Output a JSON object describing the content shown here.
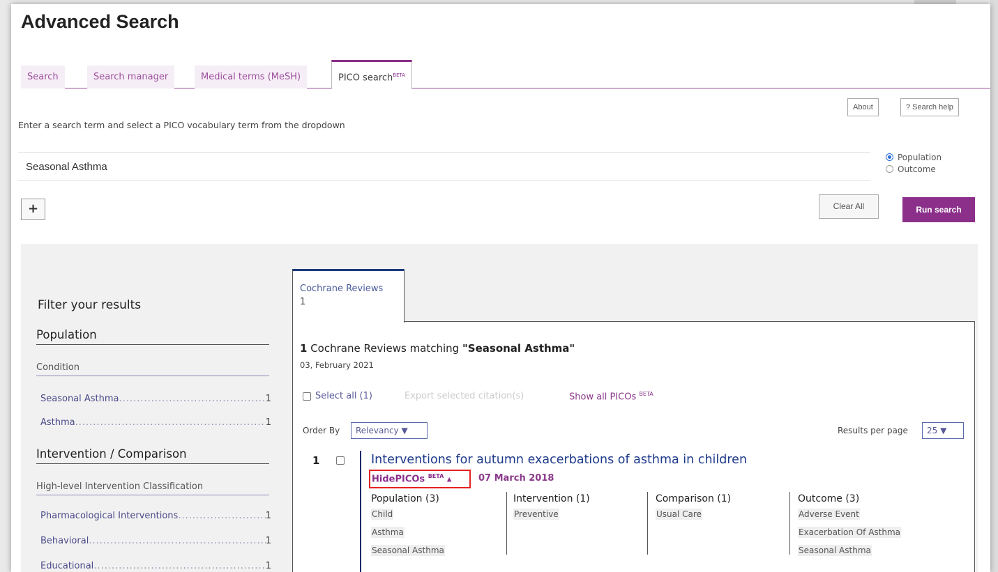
{
  "page_title": "Advanced Search",
  "tabs": [
    {
      "label": "Search",
      "active": false
    },
    {
      "label": "Search manager",
      "active": false
    },
    {
      "label": "Medical terms (MeSH)",
      "active": false
    },
    {
      "label": "PICO search",
      "sup": "BETA",
      "active": true
    }
  ],
  "help_buttons": {
    "about": "About",
    "search_help": "? Search help"
  },
  "hint": "Enter a search term and select a PICO vocabulary term from the dropdown",
  "search": {
    "value": "Seasonal Asthma",
    "placeholder": ""
  },
  "radio": {
    "options": [
      "Population",
      "Outcome"
    ],
    "selected": "Population"
  },
  "buttons": {
    "plus": "+",
    "clear_all": "Clear All",
    "run_search": "Run search"
  },
  "filters": {
    "title": "Filter your results",
    "sections": [
      {
        "heading": "Population",
        "subheading": "Condition",
        "items": [
          {
            "label": "Seasonal Asthma",
            "count": "1"
          },
          {
            "label": "Asthma",
            "count": "1"
          }
        ]
      },
      {
        "heading": "Intervention / Comparison",
        "subheading": "High-level Intervention Classification",
        "items": [
          {
            "label": "Pharmacological Interventions",
            "count": "1"
          },
          {
            "label": "Behavioral",
            "count": "1"
          },
          {
            "label": "Educational",
            "count": "1"
          }
        ]
      }
    ]
  },
  "results_tab": {
    "label": "Cochrane Reviews",
    "count": "1"
  },
  "results": {
    "count": "1",
    "heading_text": " Cochrane Reviews matching ",
    "query": "\"Seasonal Asthma\"",
    "date": "03, February 2021",
    "select_all": "Select all (1)",
    "export": "Export selected citation(s)",
    "show_all_picos": "Show all PICOs",
    "show_all_sup": "BETA",
    "order_by_label": "Order By",
    "order_by_value": "Relevancy",
    "results_per_page_label": "Results per page",
    "results_per_page_value": "25"
  },
  "review": {
    "number": "1",
    "title": "Interventions for autumn exacerbations of asthma in children",
    "hide_picos": "HidePICOs",
    "hide_picos_sup": "BETA",
    "date": "07 March 2018",
    "pico": [
      {
        "heading": "Population (3)",
        "terms": [
          "Child",
          "Asthma",
          "Seasonal Asthma"
        ]
      },
      {
        "heading": "Intervention (1)",
        "terms": [
          "Preventive"
        ]
      },
      {
        "heading": "Comparison (1)",
        "terms": [
          "Usual Care"
        ]
      },
      {
        "heading": "Outcome (3)",
        "terms": [
          "Adverse Event",
          "Exacerbation Of Asthma",
          "Seasonal Asthma"
        ]
      }
    ]
  },
  "colors": {
    "accent_purple": "#8b2f8b",
    "link_navy": "#1d3a8a",
    "highlight_red": "#e52222"
  }
}
